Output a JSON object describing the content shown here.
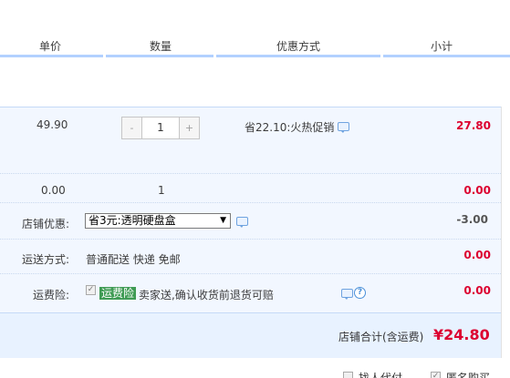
{
  "header": {
    "unit_price": "单价",
    "quantity": "数量",
    "discount": "优惠方式",
    "subtotal": "小计"
  },
  "item": {
    "price": "49.90",
    "qty_minus": "-",
    "qty_value": "1",
    "qty_plus": "+",
    "promo": "省22.10:火热促销",
    "subtotal": "27.80"
  },
  "gift": {
    "price": "0.00",
    "qty": "1",
    "subtotal": "0.00"
  },
  "shop_discount": {
    "label": "店铺优惠:",
    "selected": "省3元:透明硬盘盒",
    "amount": "-3.00"
  },
  "shipping": {
    "label": "运送方式:",
    "value": "普通配送 快递 免邮",
    "amount": "0.00"
  },
  "insurance": {
    "label": "运费险:",
    "badge": "运费险",
    "desc": "卖家送,确认收货前退货可赔",
    "help": "?",
    "amount": "0.00"
  },
  "total": {
    "label": "店铺合计(含运费)",
    "amount": "¥24.80"
  },
  "footer": {
    "option1": "找人代付",
    "option2": "匿名购买"
  }
}
